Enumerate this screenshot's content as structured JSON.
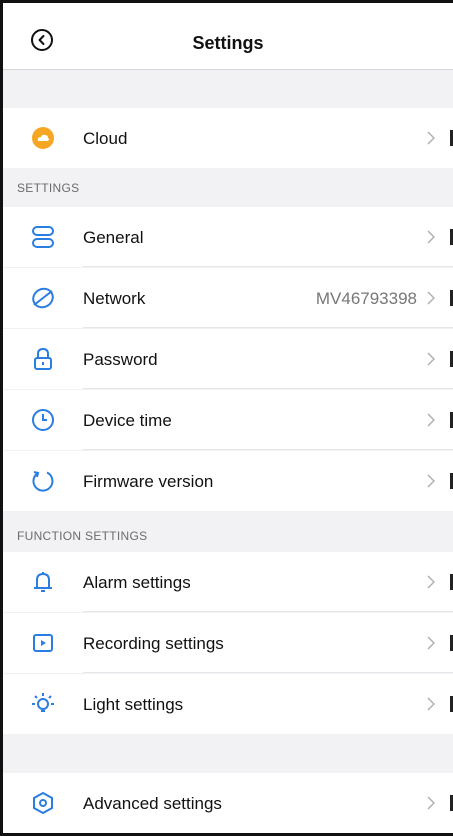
{
  "header": {
    "title": "Settings"
  },
  "cloud": {
    "label": "Cloud"
  },
  "settings_section": {
    "header": "SETTINGS",
    "items": [
      {
        "label": "General",
        "value": ""
      },
      {
        "label": "Network",
        "value": "MV46793398"
      },
      {
        "label": "Password",
        "value": ""
      },
      {
        "label": "Device time",
        "value": ""
      },
      {
        "label": "Firmware version",
        "value": ""
      }
    ]
  },
  "function_section": {
    "header": "FUNCTION SETTINGS",
    "items": [
      {
        "label": "Alarm settings"
      },
      {
        "label": "Recording settings"
      },
      {
        "label": "Light settings"
      }
    ]
  },
  "advanced": {
    "label": "Advanced settings"
  },
  "colors": {
    "accent_blue": "#2a7de1",
    "cloud_orange": "#f5a623"
  }
}
